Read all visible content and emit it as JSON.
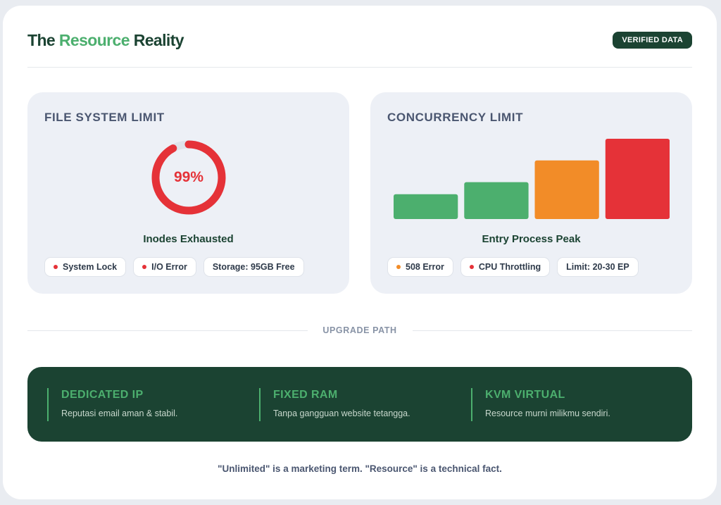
{
  "header": {
    "title_start": "The",
    "title_accent": "Resource",
    "title_end": "Reality",
    "badge": "VERIFIED DATA"
  },
  "colors": {
    "brand_dark": "#1b4332",
    "brand_green": "#4caf6e",
    "danger": "#e53238",
    "warning": "#f28c28",
    "panel_bg": "#edf0f6"
  },
  "file_system": {
    "title": "FILE SYSTEM LIMIT",
    "gauge_value": "99%",
    "gauge_fraction": 0.92,
    "label": "Inodes Exhausted",
    "chips": [
      {
        "text": "System Lock",
        "dot_color": "#e53238"
      },
      {
        "text": "I/O Error",
        "dot_color": "#e53238"
      },
      {
        "text": "Storage: 95GB Free",
        "dot_color": ""
      }
    ]
  },
  "concurrency": {
    "title": "CONCURRENCY LIMIT",
    "label": "Entry Process Peak",
    "bars": [
      {
        "level": 0.31,
        "color": "#4caf6e"
      },
      {
        "level": 0.46,
        "color": "#4caf6e"
      },
      {
        "level": 0.73,
        "color": "#f28c28"
      },
      {
        "level": 1.0,
        "color": "#e53238"
      }
    ],
    "chips": [
      {
        "text": "508 Error",
        "dot_color": "#f28c28"
      },
      {
        "text": "CPU Throttling",
        "dot_color": "#e53238"
      },
      {
        "text": "Limit: 20-30 EP",
        "dot_color": ""
      }
    ]
  },
  "upgrade": {
    "label": "UPGRADE PATH",
    "features": [
      {
        "title": "DEDICATED IP",
        "desc": "Reputasi email aman & stabil."
      },
      {
        "title": "FIXED RAM",
        "desc": "Tanpa gangguan website tetangga."
      },
      {
        "title": "KVM VIRTUAL",
        "desc": "Resource murni milikmu sendiri."
      }
    ]
  },
  "footer": {
    "text": "\"Unlimited\" is a marketing term. \"Resource\" is a technical fact."
  }
}
